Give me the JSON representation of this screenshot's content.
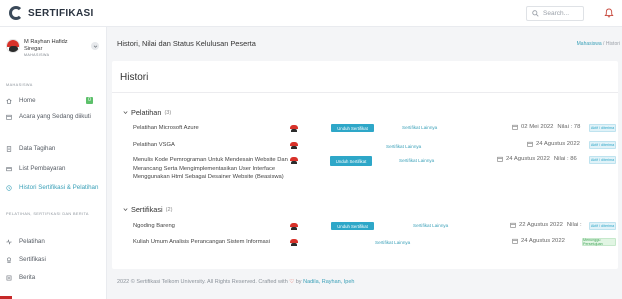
{
  "app": {
    "title": "SERTIFIKASI"
  },
  "search": {
    "placeholder": "Search..."
  },
  "user": {
    "name": "M Rayhan Hafidz Siregar",
    "role": "MAHASISWA"
  },
  "sidebar": {
    "section_mahasiswa": "MAHASISWA",
    "section_pelatihan": "PELATIHAN, SERTIFIKASI DAN BERITA",
    "items": [
      {
        "label": "Home",
        "icon": "home-icon",
        "badge": "0"
      },
      {
        "label": "Acara yang Sedang diikuti",
        "icon": "calendar-icon"
      },
      {
        "label": "Data Tagihan",
        "icon": "receipt-icon"
      },
      {
        "label": "List Pembayaran",
        "icon": "card-icon"
      },
      {
        "label": "Histori Sertifikasi & Pelatihan",
        "icon": "history-icon",
        "active": true
      },
      {
        "label": "Pelatihan",
        "icon": "pulse-icon"
      },
      {
        "label": "Sertifikasi",
        "icon": "certificate-icon"
      },
      {
        "label": "Berita",
        "icon": "news-icon"
      }
    ]
  },
  "page": {
    "title": "Histori, Nilai dan Status Kelulusan Peserta",
    "breadcrumb_parent": "Mahasiswa",
    "breadcrumb_sep": "/",
    "breadcrumb_current": "Histori"
  },
  "card": {
    "title": "Histori",
    "groups": [
      {
        "label": "Pelatihan",
        "count": "(3)"
      },
      {
        "label": "Sertifikasi",
        "count": "(2)"
      }
    ]
  },
  "rows": [
    {
      "name": "Pelatihan Microsoft Azure",
      "button": "Unduh Sertifikat",
      "link": "Sertifikat Lainnya",
      "date": "02 Mei 2022",
      "nilai": "Nilai : 78",
      "status": "Aktif / diterima",
      "status_type": "ok"
    },
    {
      "name": "Pelatihan VSGA",
      "button": "",
      "link": "Sertifikat Lainnya",
      "date": "24 Agustus 2022",
      "nilai": "",
      "status": "Aktif / diterima",
      "status_type": "ok"
    },
    {
      "name": "Menulis Kode Pemrograman Untuk Mendesain Website Dan Merancang Serta Mengimplementasikan User Interface Menggunakan Html Sebagai Desainer Website (Beasiswa)",
      "button": "Unduh Sertifikat",
      "link": "Sertifikat Lainnya",
      "date": "24 Agustus 2022",
      "nilai": "Nilai : 86",
      "status": "Aktif / diterima",
      "status_type": "ok"
    },
    {
      "name": "Ngoding Bareng",
      "button": "Unduh Sertifikat",
      "link": "Sertifikat Lainnya",
      "date": "22 Agustus 2022",
      "nilai": "Nilai :",
      "status": "Aktif / diterima",
      "status_type": "ok"
    },
    {
      "name": "Kuliah Umum Analisis Perancangan Sistem Informasi",
      "button": "",
      "link": "Sertifikat Lainnya",
      "date": "24 Agustus 2022",
      "nilai": "",
      "status": "Menunggu Persetujuan",
      "status_type": "wait"
    }
  ],
  "footer": {
    "text": "2022 © Sertifikasi Telkom University. All Rights Reserved. Crafted with",
    "heart": "♡",
    "by": "by",
    "authors": "Nadila, Rayhan, Ipeh"
  },
  "colors": {
    "accent": "#2ea7c8",
    "status_ok": "#e0f2f8",
    "status_wait": "#e1f5e3",
    "brand_red": "#d8322a",
    "badge_green": "#5cc06a"
  }
}
